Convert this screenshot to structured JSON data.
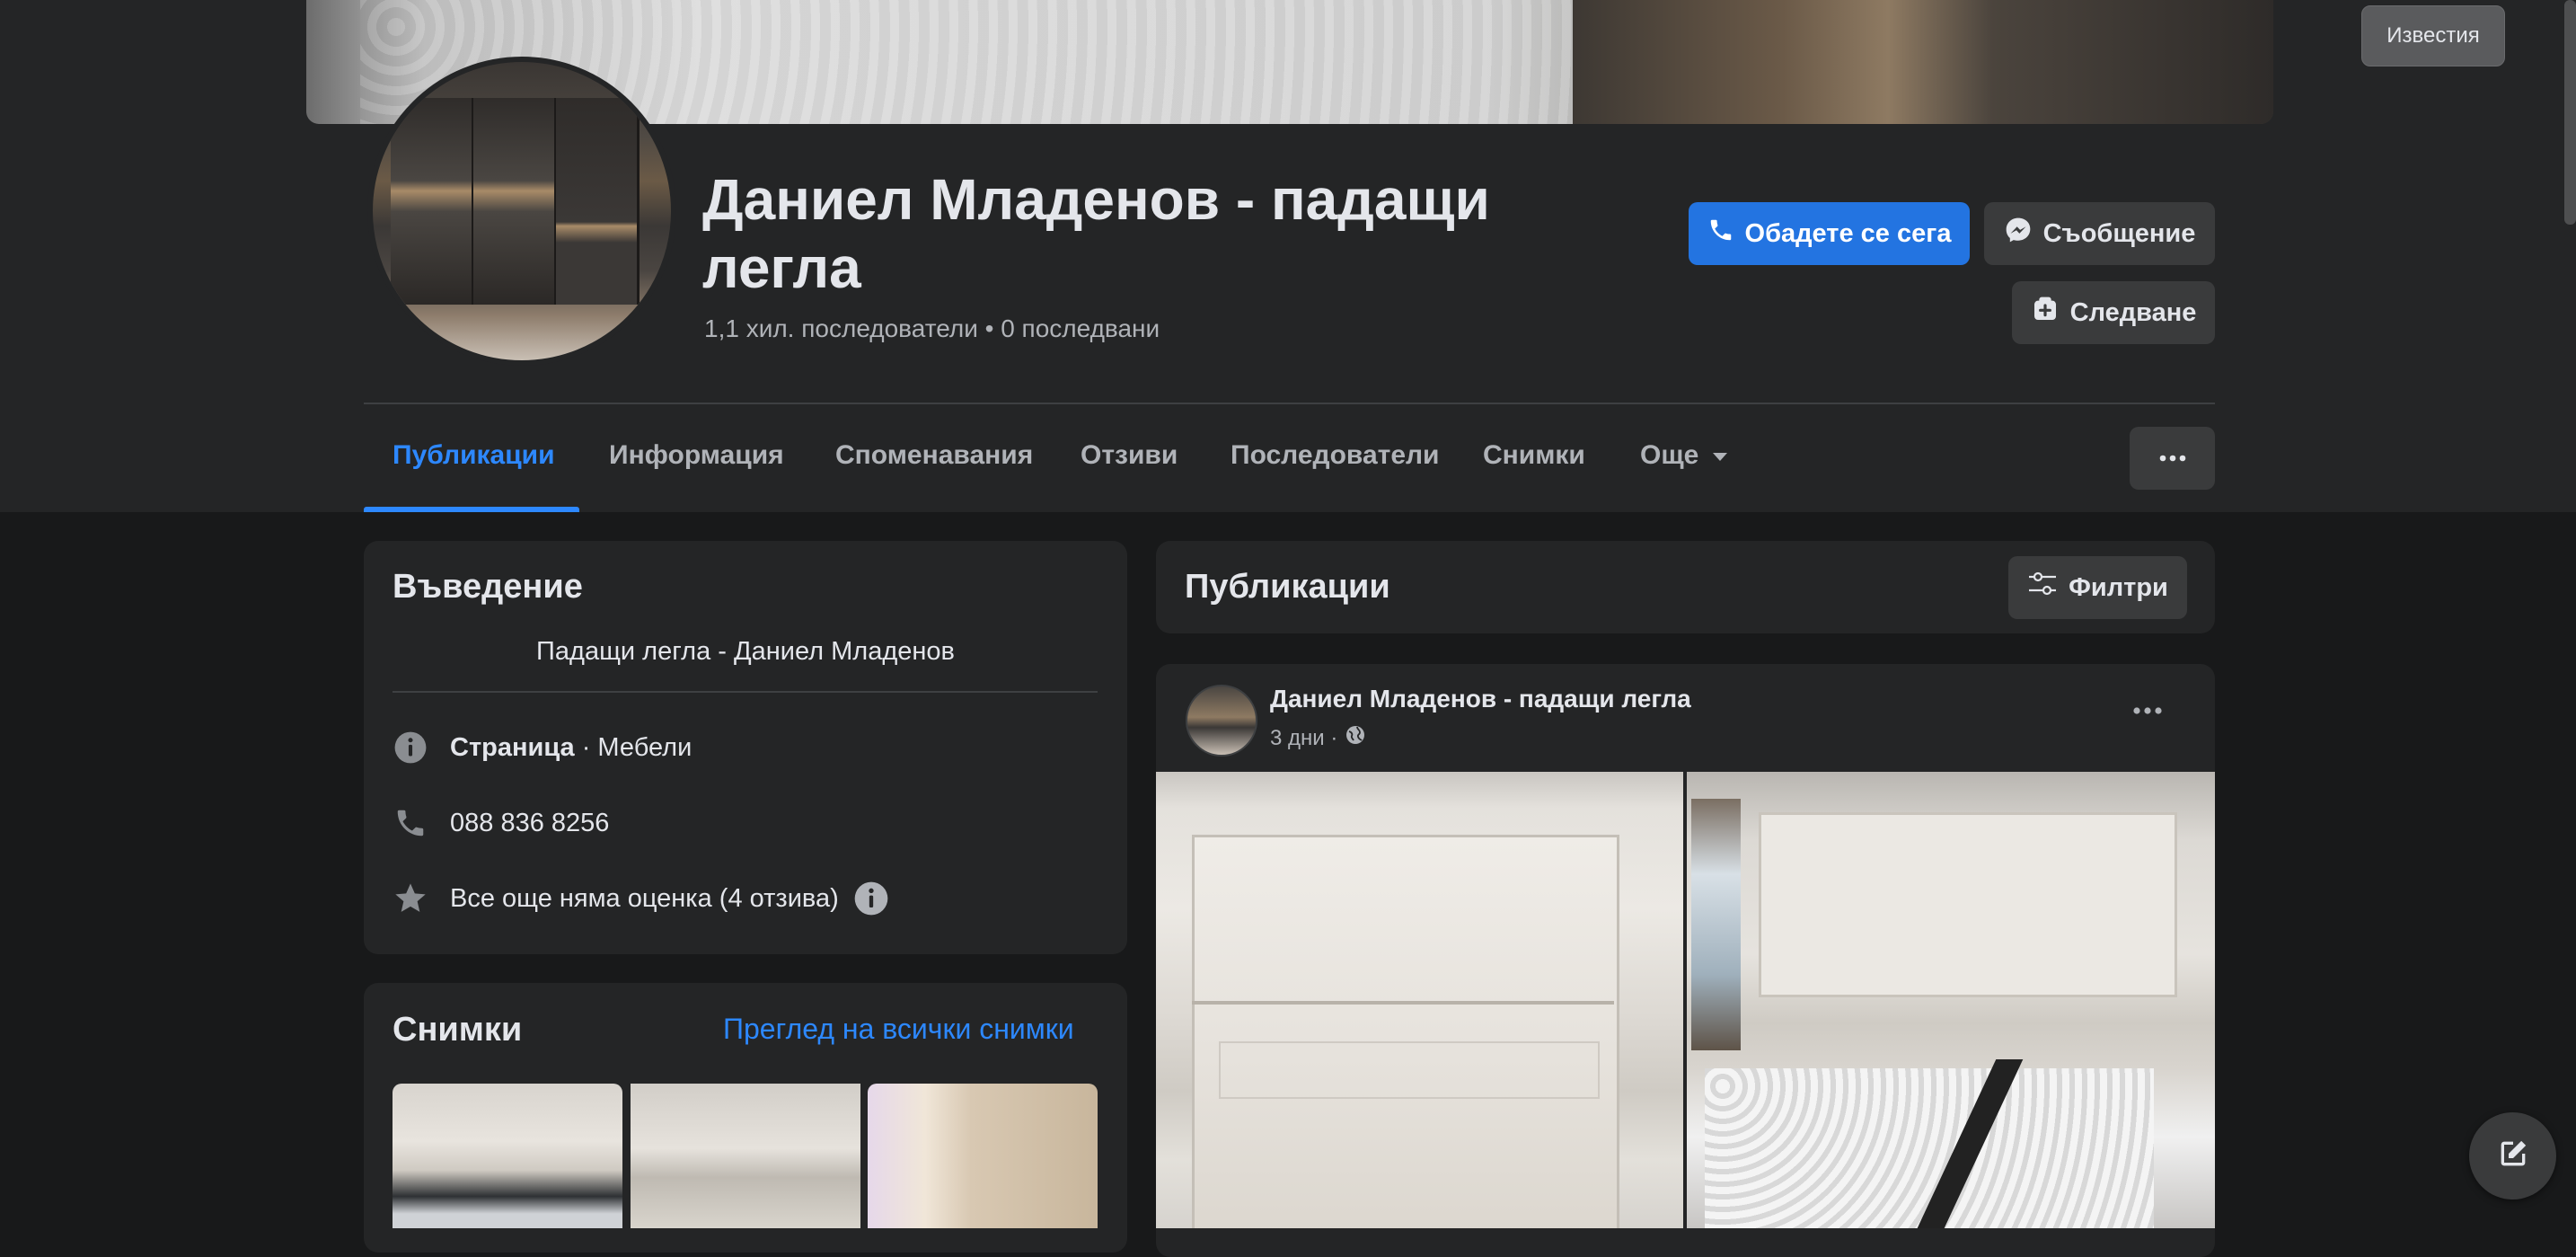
{
  "header": {
    "news_label": "Известия",
    "page_name": "Даниел Младенов - падащи легла",
    "stats": "1,1 хил. последователи • 0 последвани",
    "call_label": "Обадете се сега",
    "message_label": "Съобщение",
    "follow_label": "Следване"
  },
  "tabs": [
    {
      "label": "Публикации",
      "active": true
    },
    {
      "label": "Информация"
    },
    {
      "label": "Споменавания"
    },
    {
      "label": "Отзиви"
    },
    {
      "label": "Последователи"
    },
    {
      "label": "Снимки"
    },
    {
      "label": "Още"
    }
  ],
  "intro": {
    "title": "Въведение",
    "subtitle": "Падащи легла - Даниел Младенов",
    "category_label": "Страница",
    "category_value": " · Мебели",
    "phone": "088 836 8256",
    "rating": "Все още няма оценка (4 отзива)"
  },
  "photos": {
    "title": "Снимки",
    "see_all": "Преглед на всички снимки"
  },
  "posts": {
    "title": "Публикации",
    "filter_label": "Филтри",
    "post": {
      "author": "Даниел Младенов - падащи легла",
      "time": "3 дни ·"
    }
  },
  "colors": {
    "accent": "#2374e1",
    "link": "#2d88ff",
    "background": "#18191a",
    "surface": "#242526"
  },
  "icons": [
    "phone-icon",
    "messenger-icon",
    "follow-icon",
    "more-icon",
    "chevron-down-icon",
    "info-icon",
    "star-icon",
    "filter-icon",
    "globe-icon",
    "compose-icon"
  ]
}
